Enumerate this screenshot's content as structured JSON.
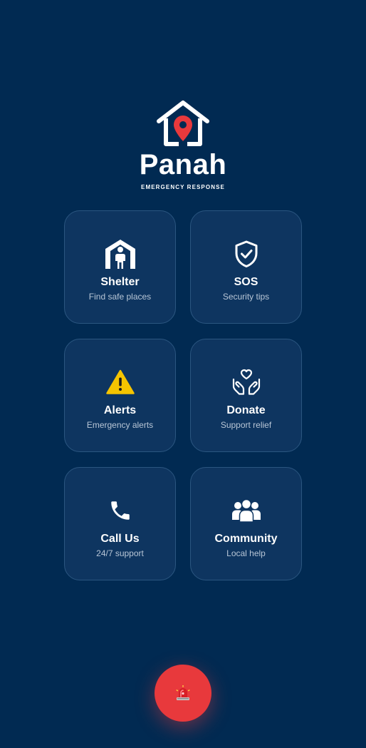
{
  "app": {
    "name": "Panah",
    "tagline": "EMERGENCY RESPONSE"
  },
  "cards": [
    {
      "title": "Shelter",
      "subtitle": "Find safe places",
      "icon": "shelter-person-icon"
    },
    {
      "title": "SOS",
      "subtitle": "Security tips",
      "icon": "shield-check-icon"
    },
    {
      "title": "Alerts",
      "subtitle": "Emergency alerts",
      "icon": "warning-icon"
    },
    {
      "title": "Donate",
      "subtitle": "Support relief",
      "icon": "heart-hands-icon"
    },
    {
      "title": "Call Us",
      "subtitle": "24/7 support",
      "icon": "phone-icon"
    },
    {
      "title": "Community",
      "subtitle": "Local help",
      "icon": "people-icon"
    }
  ],
  "fab": {
    "icon": "siren-icon"
  },
  "colors": {
    "background": "#012a52",
    "card": "#0e3560",
    "card_border": "#2b5680",
    "accent_red": "#e8393c",
    "warning_yellow": "#f5c400"
  }
}
